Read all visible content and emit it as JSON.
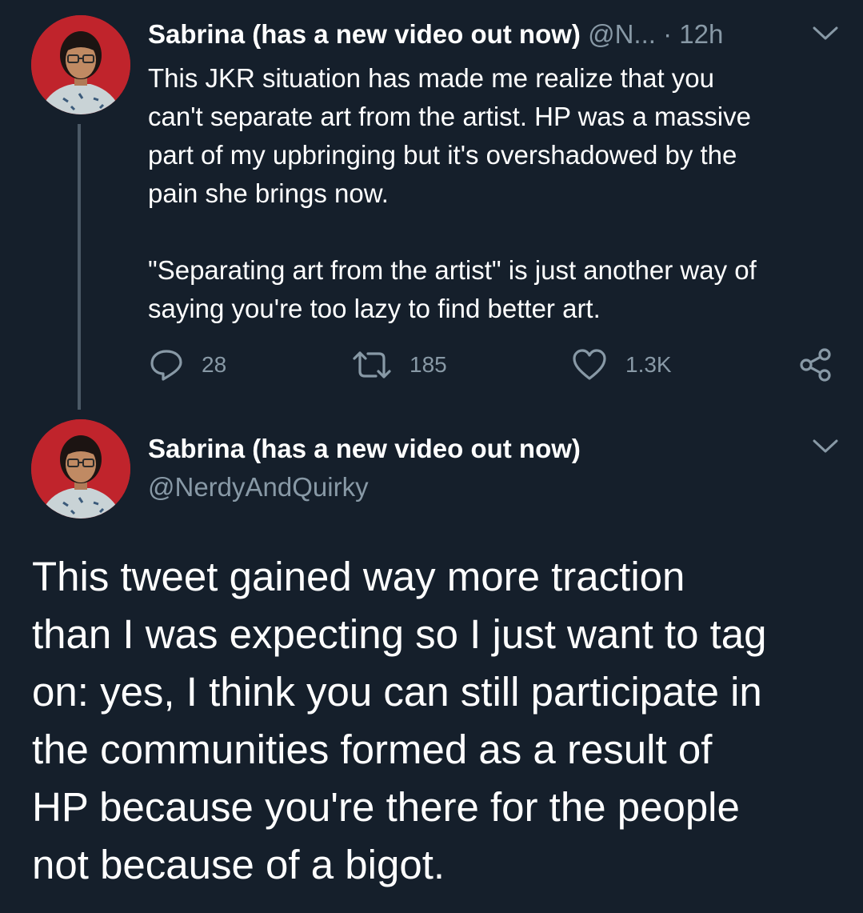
{
  "tweet1": {
    "display_name": "Sabrina (has a new video out now)",
    "handle_truncated": "@N...",
    "separator": "·",
    "time": "12h",
    "body_paragraphs": [
      [
        "This JKR situation has made me realize that you",
        "can't separate art from the artist. HP was a massive",
        "part of my upbringing but it's overshadowed by the",
        "pain she brings now."
      ],
      [
        "\"Separating art from the artist\" is just another way of",
        "saying you're too lazy to find better art."
      ]
    ],
    "actions": {
      "reply_count": "28",
      "retweet_count": "185",
      "like_count": "1.3K"
    }
  },
  "tweet2": {
    "display_name": "Sabrina (has a new video out now)",
    "handle": "@NerdyAndQuirky",
    "body_lines": [
      "This tweet gained way more traction",
      "than I was expecting so I just want to tag",
      "on: yes, I think you can still participate in",
      "the communities formed as a result of",
      "HP because you're there for the people",
      "not because of a bigot."
    ]
  },
  "icons": {
    "reply": "reply-icon",
    "retweet": "retweet-icon",
    "like": "heart-icon",
    "share": "share-icon",
    "more": "chevron-down-icon"
  },
  "colors": {
    "background": "#151f2b",
    "text_primary": "#ffffff",
    "text_secondary": "#8899a6",
    "thread_line": "#4b5966",
    "avatar_bg": "#c0242c"
  }
}
